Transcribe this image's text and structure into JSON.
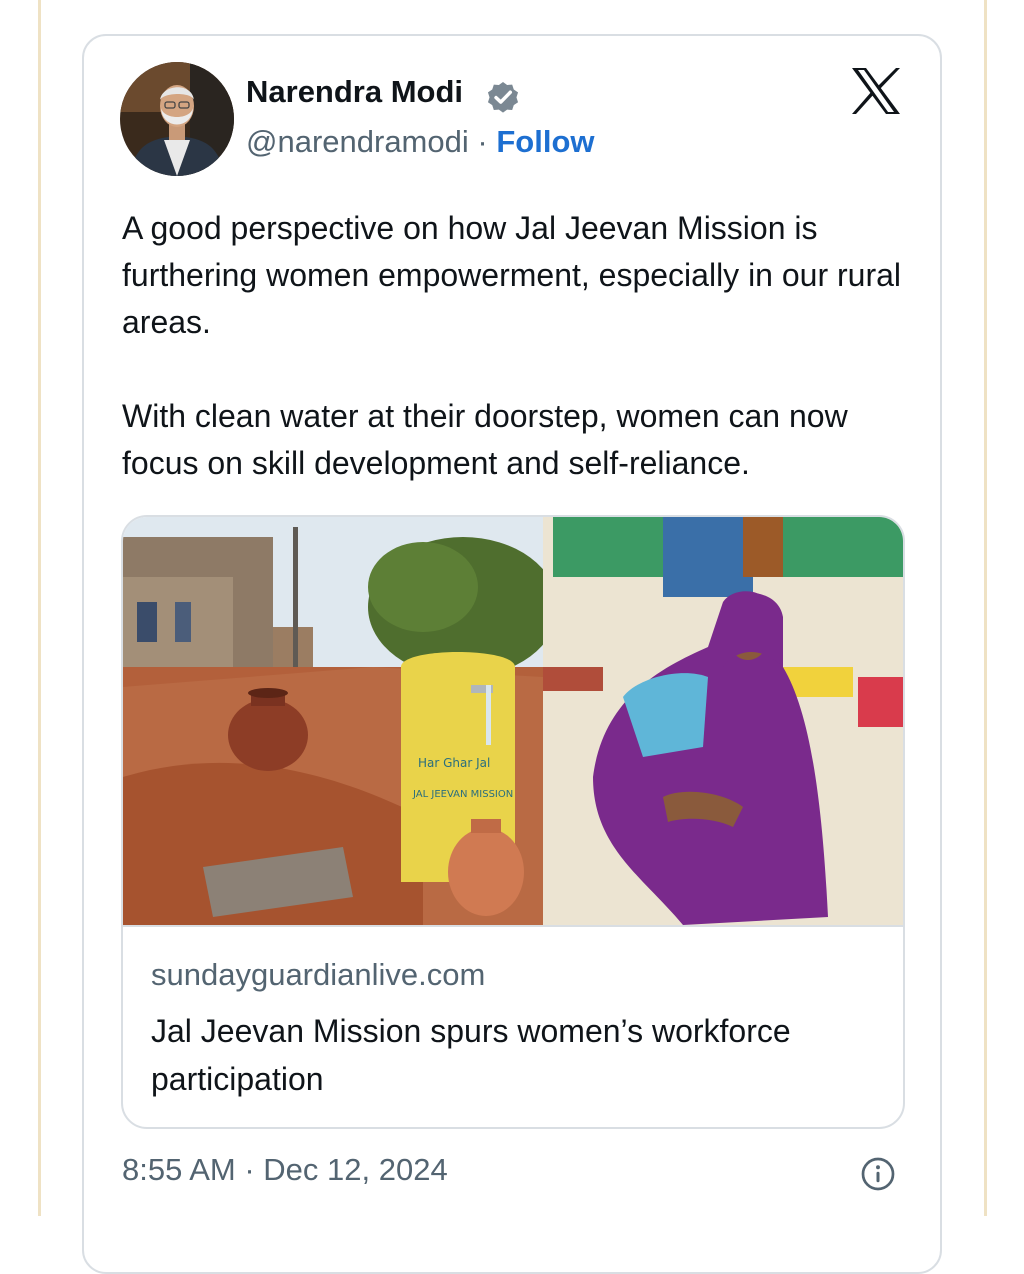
{
  "colors": {
    "text_primary": "#0f1419",
    "text_secondary": "#536471",
    "follow_blue": "#1d6fd1",
    "border": "#d9dee3",
    "verified_gray": "#7b8893"
  },
  "tweet": {
    "author": {
      "name": "Narendra Modi",
      "handle": "@narendramodi",
      "separator": "·",
      "follow_label": "Follow",
      "verified_icon": "verified-badge-icon",
      "avatar_icon": "avatar"
    },
    "brand_icon": "x-logo-icon",
    "text_paragraphs": [
      "A good perspective on how Jal Jeevan Mission is furthering women empowerment, especially in our rural areas.",
      "With clean water at their doorstep, women can now focus on skill development and self-reliance."
    ],
    "link_card": {
      "domain": "sundayguardianlive.com",
      "title": "Jal Jeevan Mission spurs women’s workforce participation",
      "image_icon": "article-photo"
    },
    "timestamp": "8:55 AM · Dec 12, 2024",
    "info_icon": "info-icon"
  }
}
